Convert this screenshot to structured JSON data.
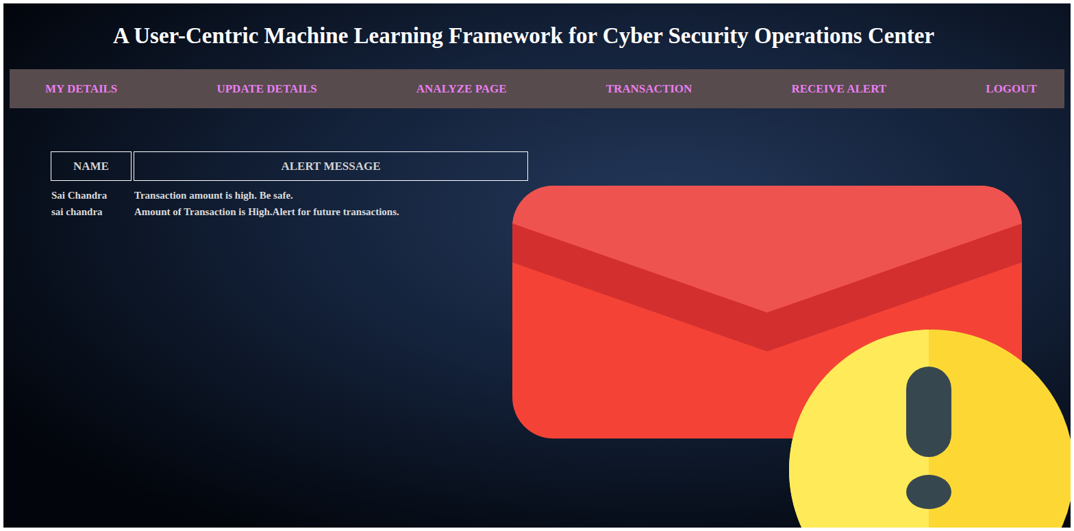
{
  "header": {
    "title": "A User-Centric Machine Learning Framework for Cyber Security Operations Center"
  },
  "nav": {
    "items": [
      "MY DETAILS",
      "UPDATE DETAILS",
      "ANALYZE PAGE",
      "TRANSACTION",
      "RECEIVE ALERT",
      "LOGOUT"
    ]
  },
  "table": {
    "columns": [
      "NAME",
      "ALERT MESSAGE"
    ],
    "rows": [
      [
        "Sai Chandra",
        "Transaction amount is high. Be safe."
      ],
      [
        "sai chandra",
        "Amount of Transaction is High.Alert for future transactions."
      ]
    ]
  }
}
